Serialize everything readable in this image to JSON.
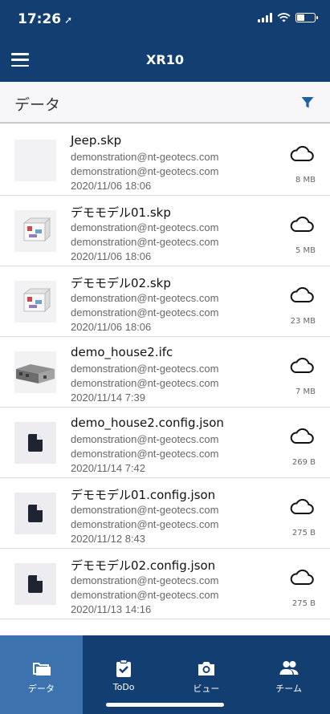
{
  "status_bar": {
    "time": "17:26"
  },
  "header": {
    "title": "XR10"
  },
  "subheader": {
    "title": "データ"
  },
  "files": [
    {
      "name": "Jeep.skp",
      "owner1": "demonstration@nt-geotecs.com",
      "owner2": "demonstration@nt-geotecs.com",
      "date": "2020/11/06 18:06",
      "size": "8 MB",
      "thumb": "blank"
    },
    {
      "name": "デモモデル01.skp",
      "owner1": "demonstration@nt-geotecs.com",
      "owner2": "demonstration@nt-geotecs.com",
      "date": "2020/11/06 18:06",
      "size": "5 MB",
      "thumb": "model-render"
    },
    {
      "name": "デモモデル02.skp",
      "owner1": "demonstration@nt-geotecs.com",
      "owner2": "demonstration@nt-geotecs.com",
      "date": "2020/11/06 18:06",
      "size": "23 MB",
      "thumb": "model-render"
    },
    {
      "name": "demo_house2.ifc",
      "owner1": "demonstration@nt-geotecs.com",
      "owner2": "demonstration@nt-geotecs.com",
      "date": "2020/11/14 7:39",
      "size": "7 MB",
      "thumb": "house-render"
    },
    {
      "name": "demo_house2.config.json",
      "owner1": "demonstration@nt-geotecs.com",
      "owner2": "demonstration@nt-geotecs.com",
      "date": "2020/11/14 7:42",
      "size": "269 B",
      "thumb": "document-icon"
    },
    {
      "name": "デモモデル01.config.json",
      "owner1": "demonstration@nt-geotecs.com",
      "owner2": "demonstration@nt-geotecs.com",
      "date": "2020/11/12 8:43",
      "size": "275 B",
      "thumb": "document-icon"
    },
    {
      "name": "デモモデル02.config.json",
      "owner1": "demonstration@nt-geotecs.com",
      "owner2": "demonstration@nt-geotecs.com",
      "date": "2020/11/13 14:16",
      "size": "275 B",
      "thumb": "document-icon"
    }
  ],
  "tabs": [
    {
      "label": "データ",
      "icon": "folder-icon",
      "active": true
    },
    {
      "label": "ToDo",
      "icon": "clipboard-check-icon",
      "active": false
    },
    {
      "label": "ビュー",
      "icon": "camera-icon",
      "active": false
    },
    {
      "label": "チーム",
      "icon": "people-icon",
      "active": false
    }
  ],
  "colors": {
    "primary": "#123e72",
    "active_tab": "#3c73ae",
    "filter": "#1f5fa8"
  }
}
